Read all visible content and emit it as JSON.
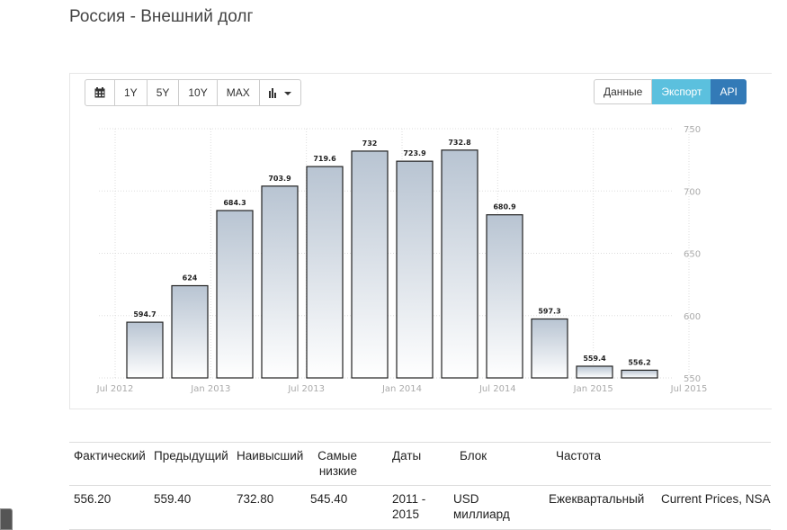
{
  "page": {
    "title": "Россия - Внешний долг"
  },
  "toolbar": {
    "calendar_icon": "calendar-icon",
    "buttons": [
      "1Y",
      "5Y",
      "10Y",
      "MAX"
    ],
    "chart_type_icon": "bar-chart-icon"
  },
  "actions": {
    "data": "Данные",
    "export": "Экспорт",
    "api": "API"
  },
  "chart_data": {
    "type": "bar",
    "categories": [
      "2012-Q3",
      "2012-Q4",
      "2013-Q1",
      "2013-Q2",
      "2013-Q3",
      "2013-Q4",
      "2014-Q1",
      "2014-Q2",
      "2014-Q3",
      "2014-Q4",
      "2015-Q1",
      "2015-Q2"
    ],
    "values": [
      594.7,
      624,
      684.3,
      703.9,
      719.6,
      732,
      723.9,
      732.8,
      680.9,
      597.3,
      559.4,
      556.2
    ],
    "value_labels": [
      "594.7",
      "624",
      "684.3",
      "703.9",
      "719.6",
      "732",
      "723.9",
      "732.8",
      "680.9",
      "597.3",
      "559.4",
      "556.2"
    ],
    "x_tick_labels": [
      "Jul 2012",
      "Jan 2013",
      "Jul 2013",
      "Jan 2014",
      "Jul 2014",
      "Jan 2015",
      "Jul 2015"
    ],
    "y_tick_labels": [
      "550",
      "600",
      "650",
      "700",
      "750"
    ],
    "ylim": [
      550,
      750
    ],
    "y_axis_position": "right",
    "grid": true,
    "colors": {
      "bar_top": "#b8c4d2",
      "bar_bottom": "#ffffff",
      "bar_border": "#222222",
      "grid": "#dddddd",
      "tick_text": "#aaaaaa"
    }
  },
  "table": {
    "headers": [
      "Фактический",
      "Предыдущий",
      "Наивысший",
      "Самые низкие",
      "Даты",
      "Блок",
      "Частота"
    ],
    "row": {
      "actual": "556.20",
      "previous": "559.40",
      "highest": "732.80",
      "lowest": "545.40",
      "dates": "2011 - 2015",
      "unit": "USD миллиард",
      "frequency": "Ежеквартальный",
      "extra": "Current Prices, NSA"
    }
  }
}
